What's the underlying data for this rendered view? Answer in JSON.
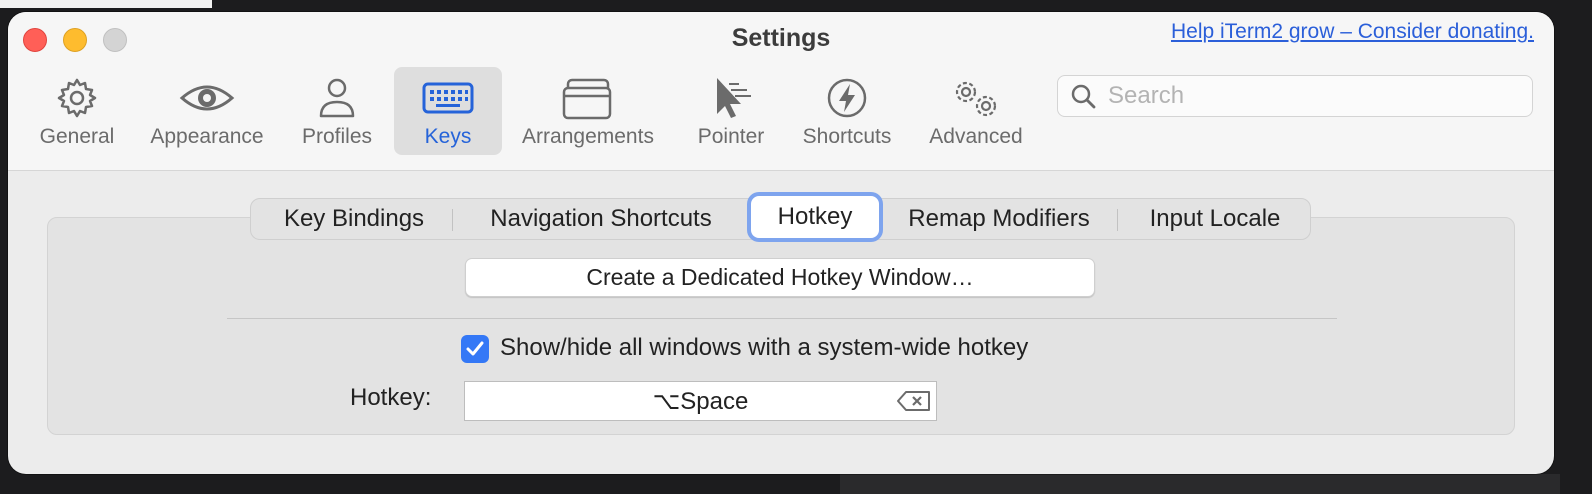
{
  "window": {
    "title": "Settings",
    "donate_link": "Help iTerm2 grow – Consider donating."
  },
  "toolbar": {
    "items": [
      {
        "label": "General",
        "icon": "gear-icon"
      },
      {
        "label": "Appearance",
        "icon": "eye-icon"
      },
      {
        "label": "Profiles",
        "icon": "person-icon"
      },
      {
        "label": "Keys",
        "icon": "keyboard-icon",
        "selected": true
      },
      {
        "label": "Arrangements",
        "icon": "windows-icon"
      },
      {
        "label": "Pointer",
        "icon": "pointer-icon"
      },
      {
        "label": "Shortcuts",
        "icon": "bolt-icon"
      },
      {
        "label": "Advanced",
        "icon": "gears-icon"
      }
    ],
    "search_placeholder": "Search"
  },
  "tabs": [
    {
      "label": "Key Bindings"
    },
    {
      "label": "Navigation Shortcuts"
    },
    {
      "label": "Hotkey",
      "selected": true
    },
    {
      "label": "Remap Modifiers"
    },
    {
      "label": "Input Locale"
    }
  ],
  "hotkey_panel": {
    "create_button": "Create a Dedicated Hotkey Window…",
    "show_hide_label": "Show/hide all windows with a system-wide hotkey",
    "show_hide_checked": true,
    "hotkey_label": "Hotkey:",
    "hotkey_value": "⌥Space"
  },
  "colors": {
    "accent": "#2563d9",
    "checkbox": "#3478f6",
    "focus_ring": "#7ea4ee"
  }
}
